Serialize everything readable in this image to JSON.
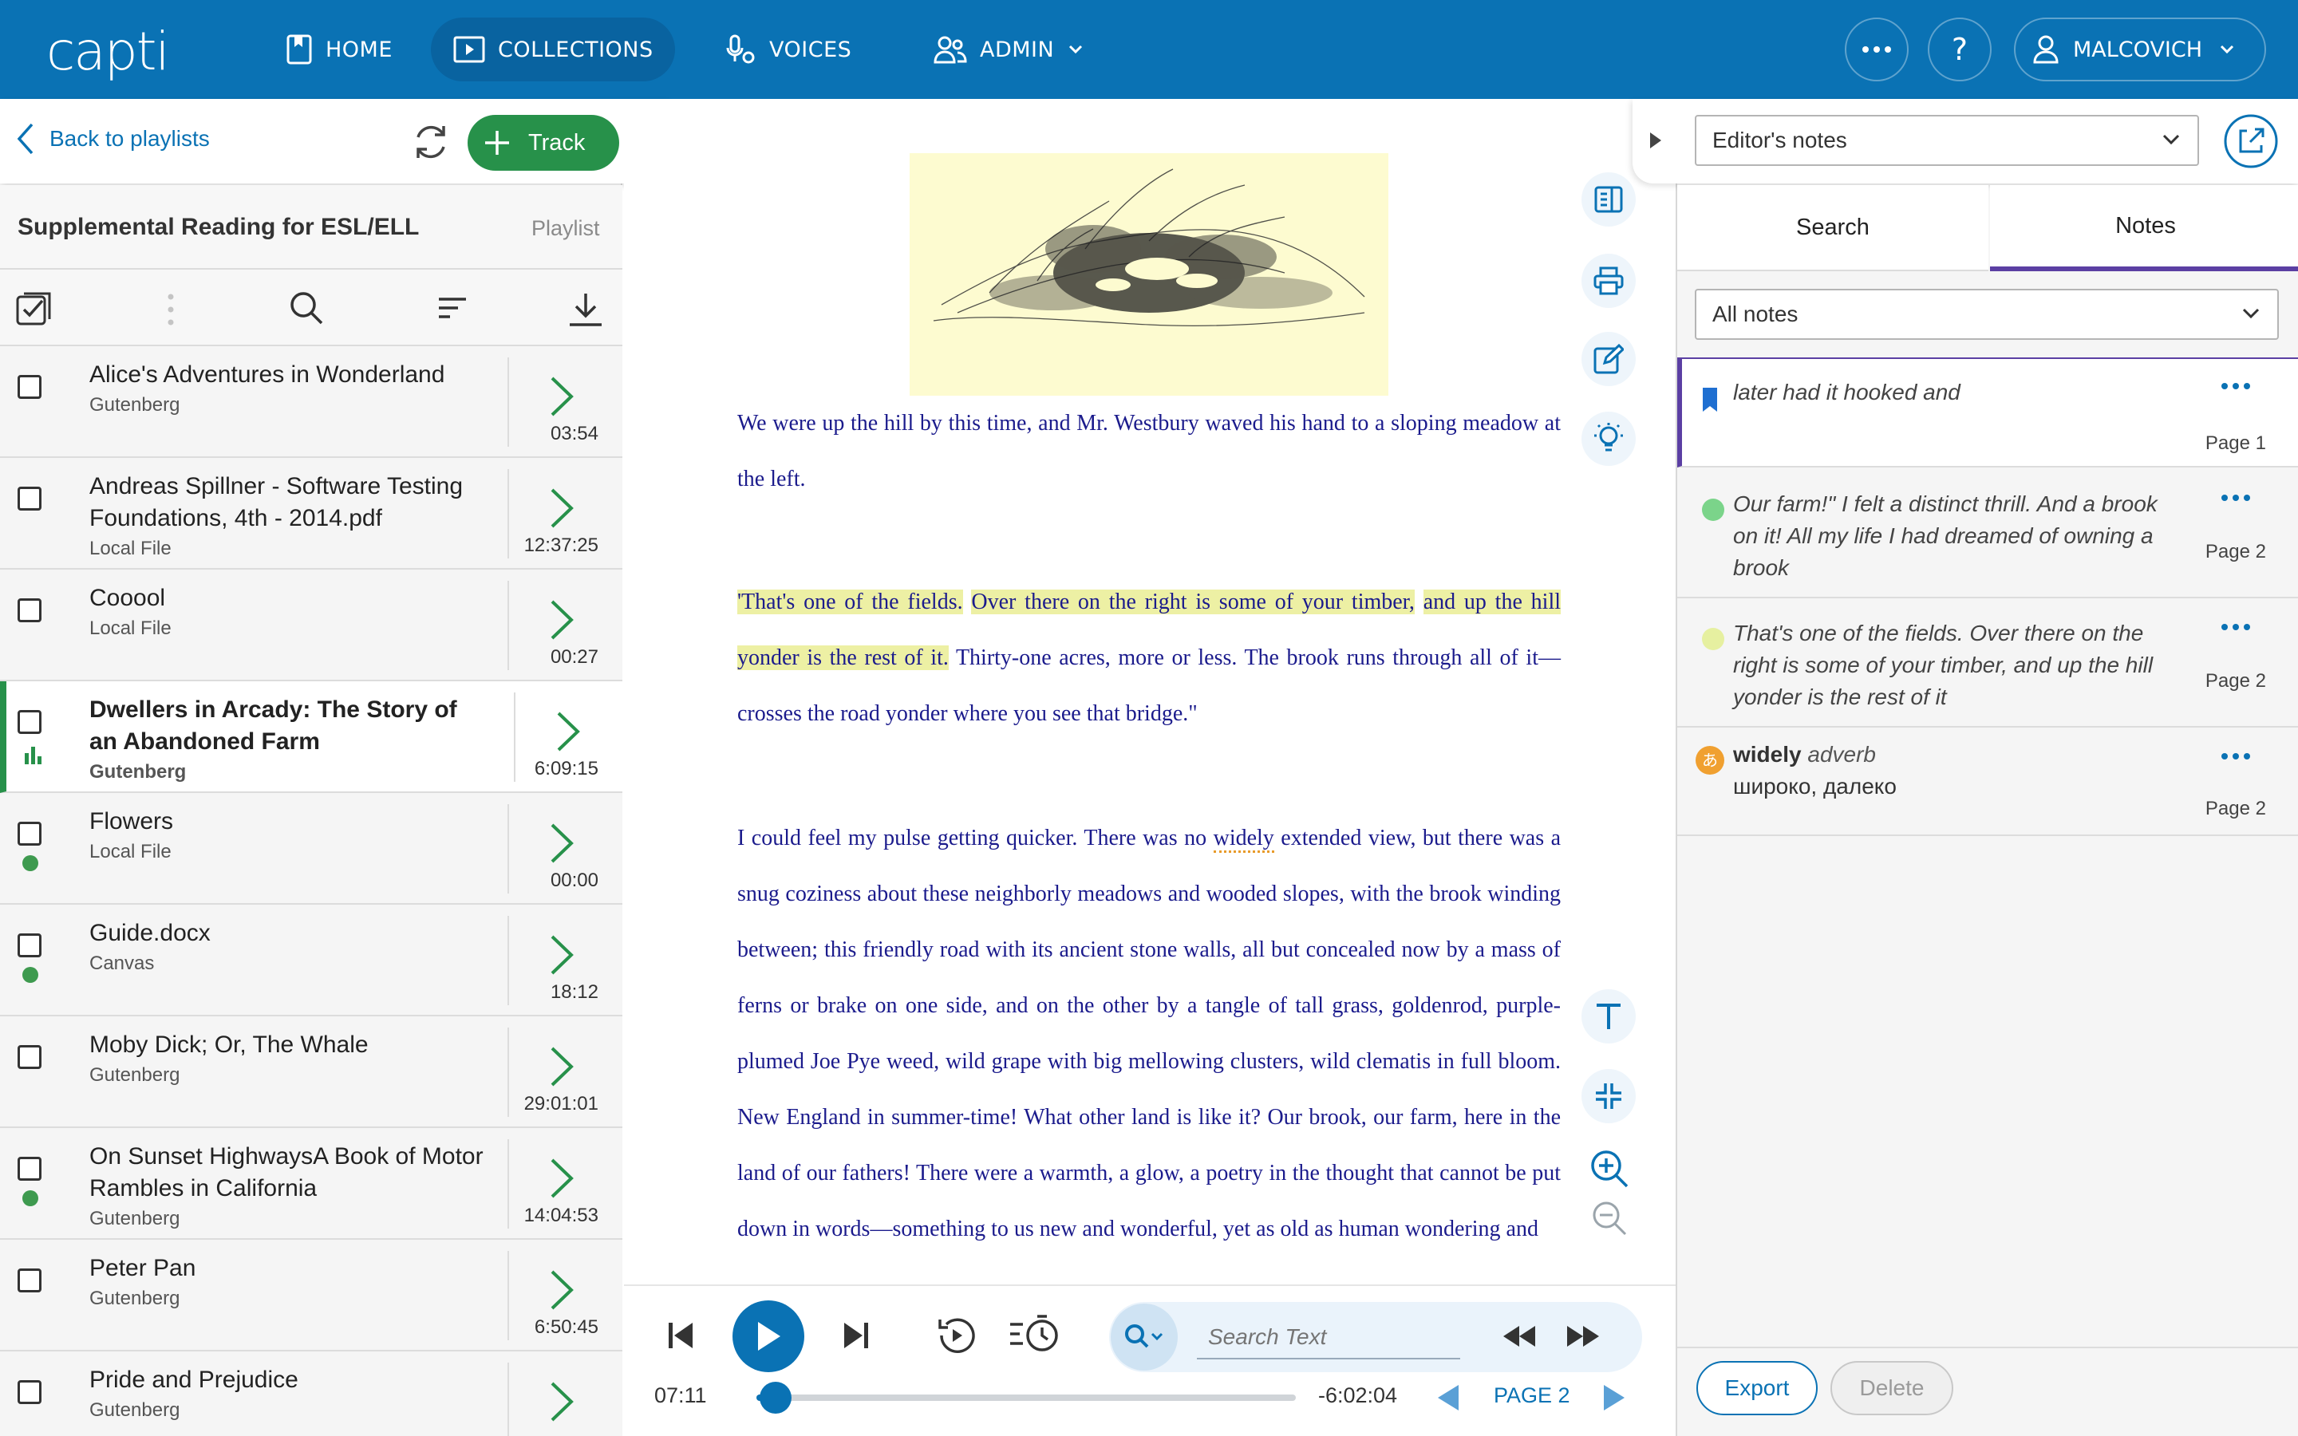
{
  "header": {
    "logo": "capti",
    "nav": [
      {
        "label": "HOME",
        "icon": "home-icon"
      },
      {
        "label": "COLLECTIONS",
        "icon": "collections-icon"
      },
      {
        "label": "VOICES",
        "icon": "voices-icon"
      },
      {
        "label": "ADMIN",
        "icon": "admin-icon"
      }
    ],
    "user": "MALCOVICH",
    "accent_color": "#0a72b4"
  },
  "left_panel": {
    "back_label": "Back to playlists",
    "track_button": "Track",
    "playlist_title": "Supplemental Reading for ESL/ELL",
    "playlist_tag": "Playlist",
    "tracks": [
      {
        "name": "Alice's Adventures in Wonderland",
        "source": "Gutenberg",
        "duration": "03:54"
      },
      {
        "name": "Andreas Spillner - Software Testing Foundations, 4th - 2014.pdf",
        "source": "Local File",
        "duration": "12:37:25"
      },
      {
        "name": "Cooool",
        "source": "Local File",
        "duration": "00:27"
      },
      {
        "name": "Dwellers in Arcady: The Story of an Abandoned Farm",
        "source": "Gutenberg",
        "duration": "6:09:15",
        "playing": true
      },
      {
        "name": "Flowers",
        "source": "Local File",
        "duration": "00:00",
        "status": "green-dot"
      },
      {
        "name": "Guide.docx",
        "source": "Canvas",
        "duration": "18:12",
        "status": "green-dot"
      },
      {
        "name": "Moby Dick; Or, The Whale",
        "source": "Gutenberg",
        "duration": "29:01:01"
      },
      {
        "name": "On Sunset HighwaysA Book of Motor Rambles in California",
        "source": "Gutenberg",
        "duration": "14:04:53",
        "status": "green-dot"
      },
      {
        "name": "Peter Pan",
        "source": "Gutenberg",
        "duration": "6:50:45"
      },
      {
        "name": "Pride and Prejudice",
        "source": "Gutenberg",
        "duration": ""
      }
    ]
  },
  "reader": {
    "p1": "We were up the hill by this time, and Mr. Westbury waved his hand to a sloping meadow at the left.",
    "p2_hl1": "'That's one of the fields.",
    "p2_hl2": "Over there on the right is some of your timber,",
    "p2_hl3": "and up the hill yonder is the rest of it.",
    "p2_rest": "Thirty-one acres, more or less. The brook runs through all of it—crosses the road yonder where you see that bridge.\"",
    "p3_a": "I could feel my pulse getting quicker. There was no",
    "p3_word": "widely",
    "p3_b": "extended view, but there was a snug coziness about these neighborly meadows and wooded slopes, with the brook winding between; this friendly road with its ancient stone walls, all but concealed now by a mass of ferns or brake on one side, and on the other by a tangle of tall grass, goldenrod, purple-plumed Joe Pye weed, wild grape with big mellowing clusters, wild clematis in full bloom. New England in summer-time! What other land is like it? Our brook, our farm, here in the land of our fathers! There were a warmth, a glow, a poetry in the thought that cannot be put down in words—something to us new and wonderful, yet as old as human wondering and"
  },
  "player": {
    "search_placeholder": "Search Text",
    "elapsed": "07:11",
    "remaining": "-6:02:04",
    "page": "PAGE 2",
    "progress": 0.02
  },
  "right_panel": {
    "notes_source": "Editor's notes",
    "tabs": [
      "Search",
      "Notes"
    ],
    "active_tab": "Notes",
    "filter": "All notes",
    "notes": [
      {
        "type": "bookmark",
        "text": "later had it hooked and",
        "page": "Page 1",
        "color": "#1f6fd1"
      },
      {
        "type": "highlight",
        "text": "Our farm!\" I felt a distinct thrill. And a brook on it! All my life I had dreamed of owning a brook",
        "page": "Page 2",
        "color": "#7bd48a"
      },
      {
        "type": "highlight",
        "text": "That's one of the fields. Over there on the right is some of your timber, and up the hill yonder is the rest of it",
        "page": "Page 2",
        "color": "#e6f0a0"
      },
      {
        "type": "vocab",
        "word": "widely",
        "pos": "adverb",
        "translation": "широко, далеко",
        "page": "Page 2",
        "color": "#f0a030"
      }
    ],
    "export_label": "Export",
    "delete_label": "Delete"
  }
}
